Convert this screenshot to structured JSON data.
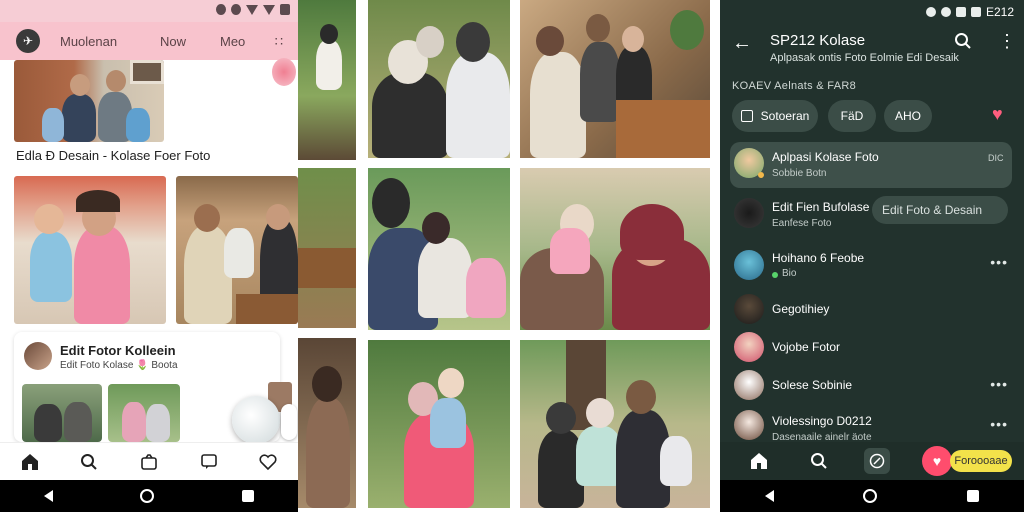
{
  "left_app": {
    "status_icons": [
      "vibrate-icon",
      "settings-icon",
      "wifi-icon",
      "signal-icon",
      "battery-icon"
    ],
    "appbar": {
      "tabs": [
        "Muolenan",
        "Now",
        "Meo"
      ],
      "more_label": "∷"
    },
    "caption": "Edla Đ  Desain  - Kolase Foer Foto",
    "card": {
      "title": "Edit Fotor Kolleein",
      "subtitle": "Edit Foto Kolase 🌷 Boota"
    },
    "bottom_nav": [
      "home-icon",
      "search-icon",
      "gallery-icon",
      "chat-icon",
      "heart-icon"
    ]
  },
  "right_app": {
    "status_time": "E212",
    "header": {
      "title": "SP212 Kolase",
      "subtitle": "Aplpasak ontis Foto Eolmie Edi Desaik"
    },
    "section_label": "KOAEV Aelnats & FAR8",
    "chips": [
      "Sotoeran",
      "FäD",
      "AHO"
    ],
    "contacts": [
      {
        "name": "Aplpasi Kolase Foto",
        "sub": "Sobbie Botn",
        "tag": "DIC"
      },
      {
        "name": "Edit Fien Bufolase",
        "sub": "Eanfese Foto",
        "pill": "Edit Foto & Desain"
      },
      {
        "name": "Hoihano 6 Feobe",
        "sub": "Bio"
      },
      {
        "name": "Gegotihiey",
        "sub": ""
      },
      {
        "name": "Vojobe Fotor",
        "sub": ""
      },
      {
        "name": "Solese Sobinie",
        "sub": ""
      },
      {
        "name": "Violessingo D0212",
        "sub": "Dasenaaile ainelr äote"
      }
    ],
    "nav_pill": "Foroooaae"
  },
  "colors": {
    "left_appbar": "#f8c3cd",
    "right_bg": "#22322d",
    "accent_pink": "#ff4d6d",
    "accent_yellow": "#f3e24a"
  }
}
